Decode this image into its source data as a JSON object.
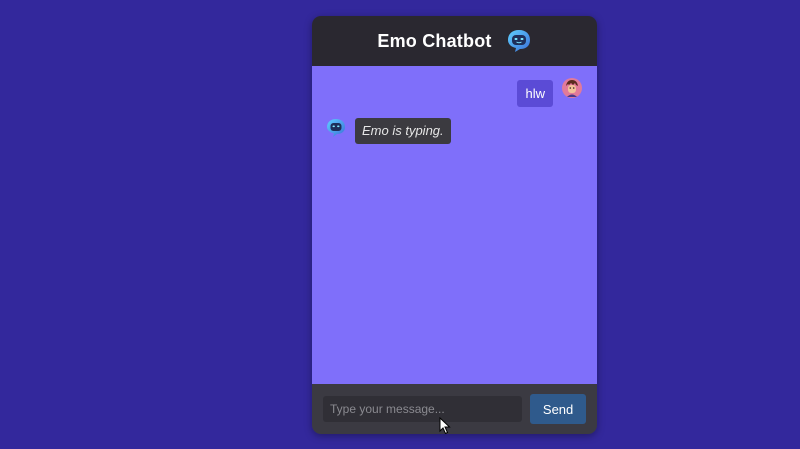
{
  "header": {
    "title": "Emo Chatbot",
    "logo_icon": "chatbot-face-icon"
  },
  "messages": [
    {
      "sender": "user",
      "text": "hlw",
      "avatar_icon": "user-avatar-icon"
    },
    {
      "sender": "bot",
      "text": "Emo is typing.",
      "avatar_icon": "bot-avatar-icon",
      "status": "typing"
    }
  ],
  "composer": {
    "placeholder": "Type your message...",
    "value": "",
    "send_label": "Send"
  },
  "colors": {
    "page_background": "#33289c",
    "header_background": "#2a2830",
    "messages_background": "#7f6ffa",
    "user_bubble": "#5b4bd6",
    "bot_bubble": "#3b3a40",
    "input_bar": "#3b3a42",
    "send_button": "#2f5a8c"
  }
}
